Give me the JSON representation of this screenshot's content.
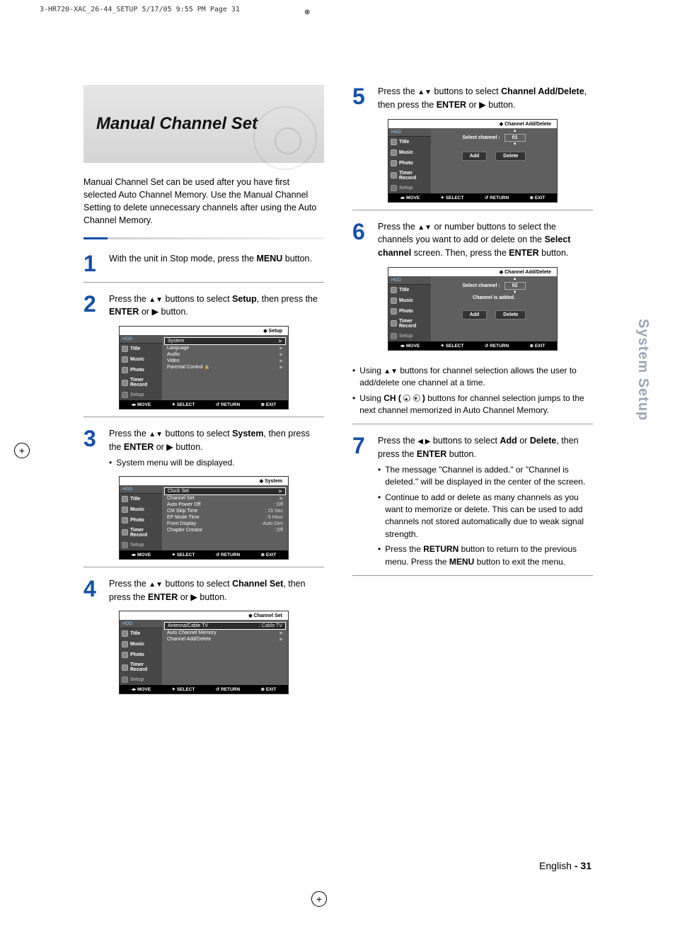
{
  "header": {
    "slug": "3-HR720-XAC_26-44_SETUP  5/17/05  9:55 PM  Page 31"
  },
  "title": "Manual Channel Set",
  "intro": "Manual Channel Set can be used after you have first selected Auto Channel Memory. Use the Manual Channel Setting to delete unnecessary channels after using the Auto Channel Memory.",
  "side_tab": "System Setup",
  "footer": {
    "lang": "English",
    "dash": " - ",
    "page": "31"
  },
  "sidebar": {
    "hdd": "HDD",
    "title": "Title",
    "music": "Music",
    "photo": "Photo",
    "timer": "Timer Record",
    "setup": "Setup"
  },
  "osd_foot": {
    "move": "◂▸ MOVE",
    "select": "✦ SELECT",
    "return": "↺ RETURN",
    "exit": "⊕ EXIT"
  },
  "steps": {
    "s1": {
      "pre": "With the unit in Stop mode, press the ",
      "b": "MENU",
      "post": " button."
    },
    "s2": {
      "t1": "Press the ",
      "arrows": "▲▼",
      "t2": " buttons to select ",
      "b1": "Setup",
      "t3": ", then press the ",
      "b2": "ENTER",
      "t4": " or ",
      "play": "▶",
      "t5": " button."
    },
    "s3": {
      "t1": "Press the ",
      "arrows": "▲▼",
      "t2": " buttons to select ",
      "b1": "System",
      "t3": ", then press the ",
      "b2": "ENTER",
      "t4": " or ",
      "play": "▶",
      "t5": " button.",
      "sub": "System menu will be displayed."
    },
    "s4": {
      "t1": "Press the ",
      "arrows": "▲▼",
      "t2": " buttons to select ",
      "b1": "Channel Set",
      "t3": ", then press the ",
      "b2": "ENTER",
      "t4": " or ",
      "play": "▶",
      "t5": " button."
    },
    "s5": {
      "t1": "Press the ",
      "arrows": "▲▼",
      "t2": " buttons to select ",
      "b1": "Channel Add/Delete",
      "t3": ", then press the ",
      "b2": "ENTER",
      "t4": " or ",
      "play": "▶",
      "t5": " button."
    },
    "s6": {
      "t1": "Press the ",
      "arrows": "▲▼",
      "t2": " or number buttons to select the channels you want to add or delete on the ",
      "b1": "Select channel",
      "t3": " screen. Then, press the ",
      "b2": "ENTER",
      "t4": " button.",
      "b_a": "Using ",
      "b_arrows": "▲▼",
      "b_a2": " buttons for channel selection allows the user to add/delete one channel at a time.",
      "b_b": "Using  ",
      "ch": "CH (",
      "ch2": " )",
      "b_b2": " buttons for channel selection jumps to the next channel memorized in Auto Channel Memory."
    },
    "s7": {
      "t1": "Press the ",
      "arrows": "◀ ▶",
      "t2": " buttons to select ",
      "b1": "Add",
      "or": " or ",
      "b2": "Delete",
      "t3": ", then press the ",
      "b3": "ENTER",
      "t4": " button.",
      "sub1": "The message \"Channel is added.\" or \"Channel is deleted.\" will be displayed in the center of the screen.",
      "sub2": "Continue to add or delete as many channels as you want to memorize or delete. This can be used to add channels not stored automatically due to weak signal strength.",
      "sub3a": "Press the ",
      "sub3b": "RETURN",
      "sub3c": " button to return to the previous menu. Press the ",
      "sub3d": "MENU",
      "sub3e": " button to exit the menu."
    }
  },
  "osd": {
    "setup": {
      "title": "Setup",
      "items": [
        {
          "l": "System",
          "hi": true
        },
        {
          "l": "Language"
        },
        {
          "l": "Audio"
        },
        {
          "l": "Video"
        },
        {
          "l": "Parental Control",
          "lock": true
        }
      ]
    },
    "system": {
      "title": "System",
      "items": [
        {
          "l": "Clock Set",
          "hi": true
        },
        {
          "l": "Channel Set"
        },
        {
          "l": "Auto Power Off",
          "v": ": Off"
        },
        {
          "l": "CM Skip Time",
          "v": ": 15 Sec"
        },
        {
          "l": "EP Mode Time",
          "v": ": 6 Hour"
        },
        {
          "l": "Front Display",
          "v": ": Auto Dim"
        },
        {
          "l": "Chapter Creator",
          "v": ": Off"
        }
      ]
    },
    "chset": {
      "title": "Channel Set",
      "items": [
        {
          "l": "Antenna/Cable TV",
          "v": ": Cable TV",
          "hi": true
        },
        {
          "l": "Auto Channel Memory"
        },
        {
          "l": "Channel Add/Delete"
        }
      ]
    },
    "chadd1": {
      "title": "Channel Add/Delete",
      "sel": "Select channel :",
      "num": "01",
      "add": "Add",
      "del": "Delete"
    },
    "chadd2": {
      "title": "Channel Add/Delete",
      "sel": "Select channel :",
      "num": "02",
      "msg": "Channel is added.",
      "add": "Add",
      "del": "Delete"
    }
  }
}
